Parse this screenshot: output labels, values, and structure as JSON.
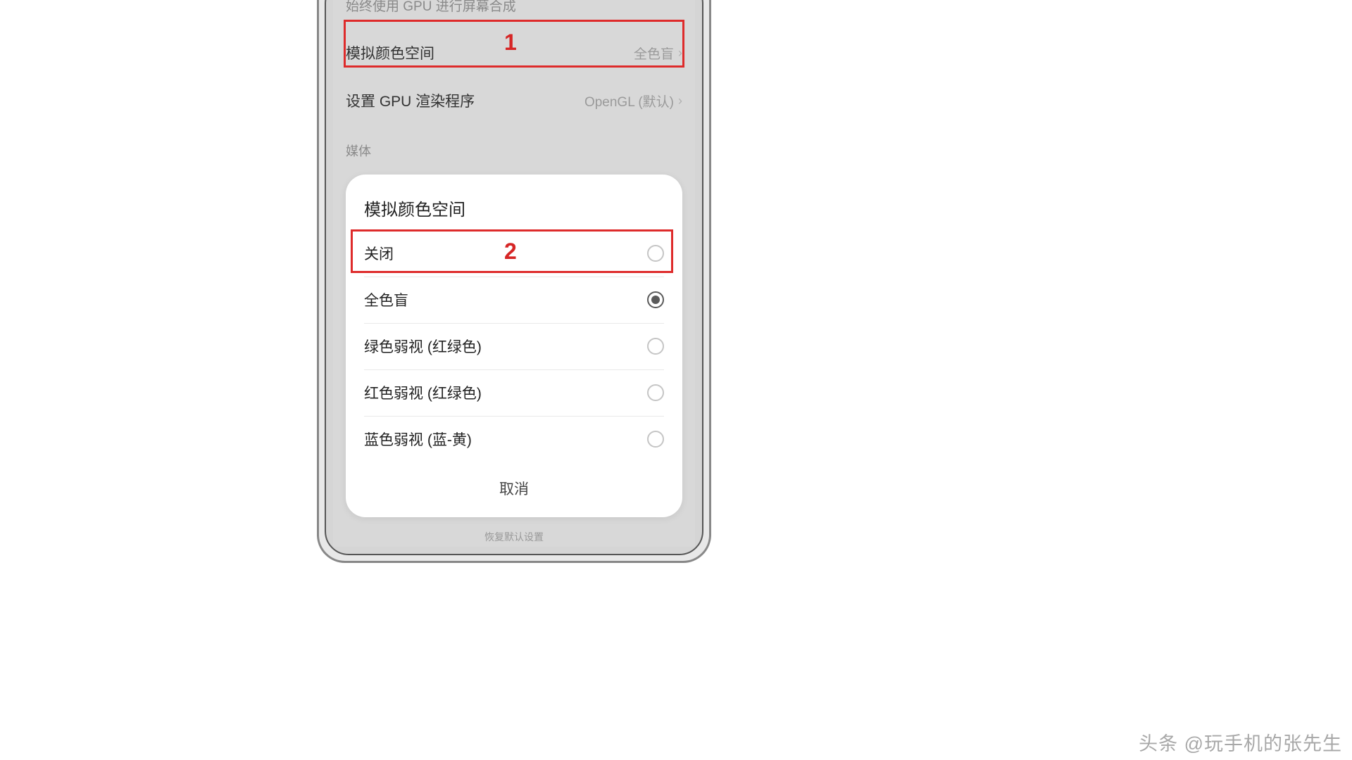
{
  "settings": {
    "gpu_compositing_label": "始终使用 GPU 进行屏幕合成",
    "color_space": {
      "label": "模拟颜色空间",
      "value": "全色盲"
    },
    "gpu_renderer": {
      "label": "设置 GPU 渲染程序",
      "value": "OpenGL (默认)"
    },
    "section_media": "媒体",
    "restore_defaults": "恢复默认设置"
  },
  "sheet": {
    "title": "模拟颜色空间",
    "options": [
      {
        "label": "关闭",
        "selected": false
      },
      {
        "label": "全色盲",
        "selected": true
      },
      {
        "label": "绿色弱视 (红绿色)",
        "selected": false
      },
      {
        "label": "红色弱视 (红绿色)",
        "selected": false
      },
      {
        "label": "蓝色弱视 (蓝-黄)",
        "selected": false
      }
    ],
    "cancel": "取消"
  },
  "callouts": {
    "one": "1",
    "two": "2"
  },
  "watermark": "头条 @玩手机的张先生"
}
